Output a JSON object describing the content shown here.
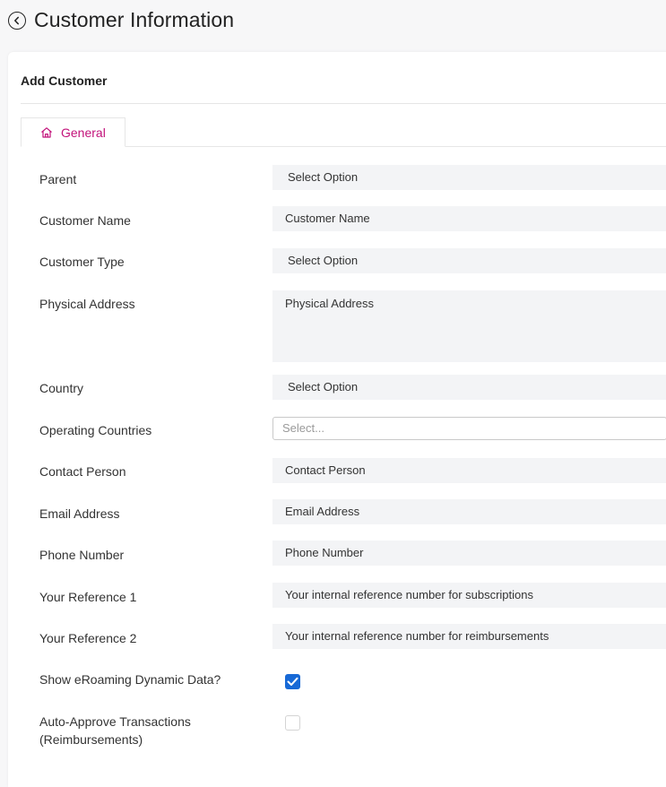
{
  "header": {
    "title": "Customer Information"
  },
  "card": {
    "title": "Add Customer"
  },
  "tabs": [
    {
      "label": "General",
      "icon": "home-icon",
      "color": "#c2127a"
    }
  ],
  "form": {
    "parent": {
      "label": "Parent",
      "value": "Select Option"
    },
    "customer_name": {
      "label": "Customer Name",
      "placeholder": "Customer Name"
    },
    "customer_type": {
      "label": "Customer Type",
      "value": "Select Option"
    },
    "physical_address": {
      "label": "Physical Address",
      "placeholder": "Physical Address"
    },
    "country": {
      "label": "Country",
      "value": "Select Option"
    },
    "operating_countries": {
      "label": "Operating Countries",
      "placeholder": "Select..."
    },
    "contact_person": {
      "label": "Contact Person",
      "placeholder": "Contact Person"
    },
    "email_address": {
      "label": "Email Address",
      "placeholder": "Email Address"
    },
    "phone_number": {
      "label": "Phone Number",
      "placeholder": "Phone Number"
    },
    "reference_1": {
      "label": "Your Reference 1",
      "placeholder": "Your internal reference number for subscriptions"
    },
    "reference_2": {
      "label": "Your Reference 2",
      "placeholder": "Your internal reference number for reimbursements"
    },
    "show_eroaming": {
      "label": "Show eRoaming Dynamic Data?",
      "checked": true
    },
    "auto_approve": {
      "label_line1": "Auto-Approve Transactions",
      "label_line2": "(Reimbursements)",
      "checked": false
    }
  },
  "colors": {
    "accent": "#c2127a",
    "checkbox": "#1769d6",
    "field_bg": "#f3f4f6"
  }
}
